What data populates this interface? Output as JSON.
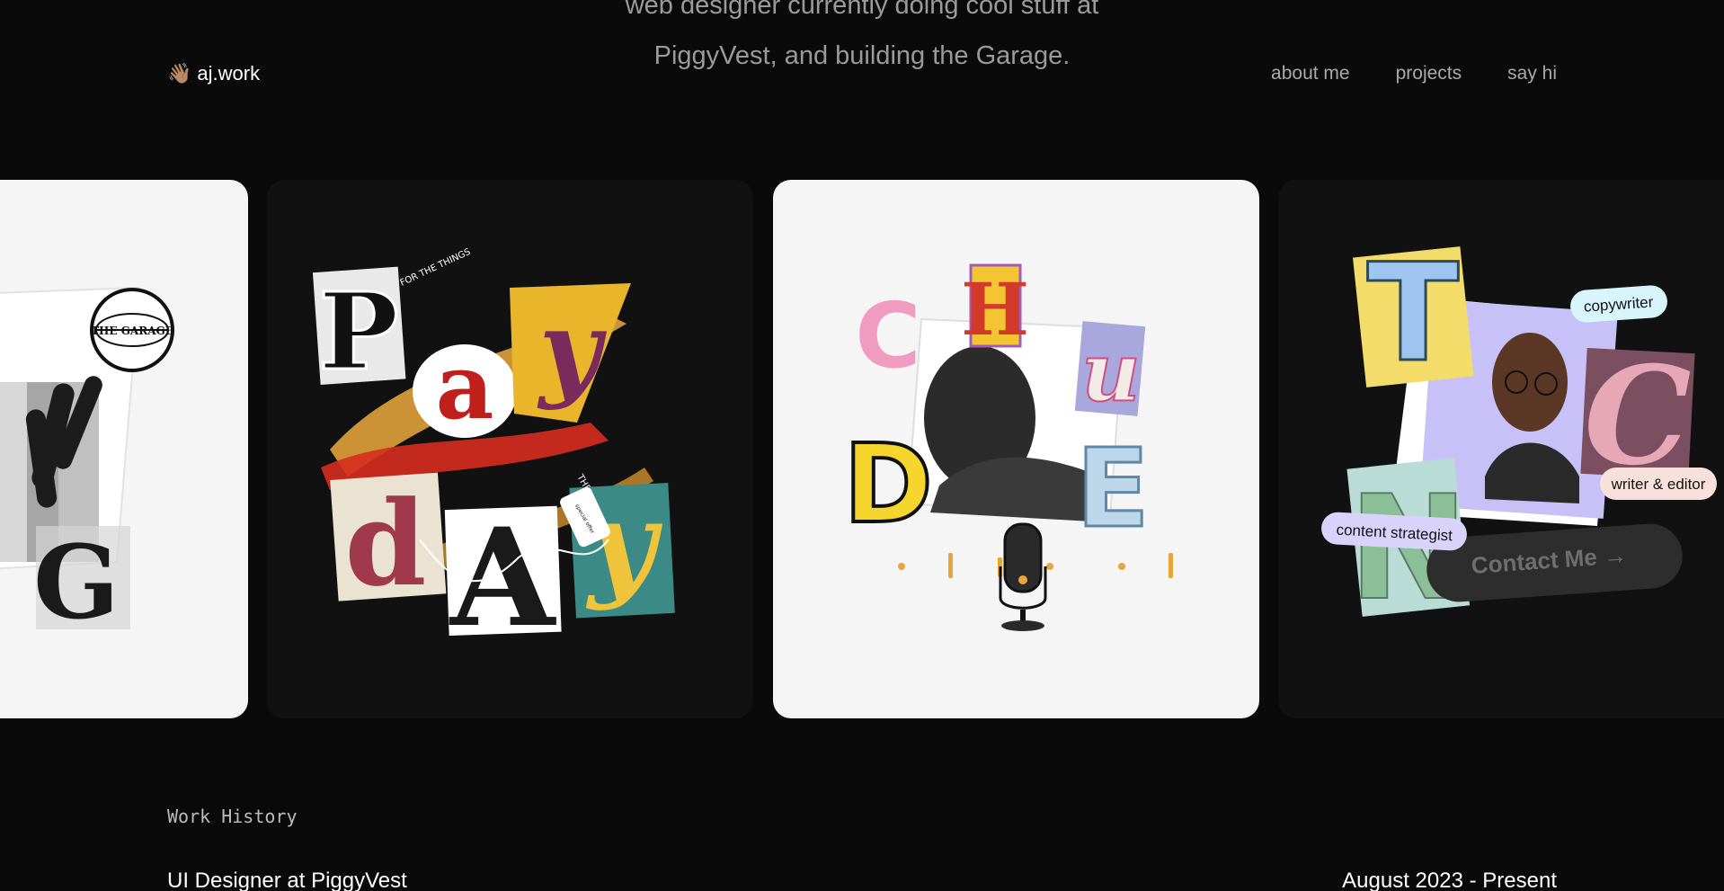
{
  "hero": {
    "line1": "web designer currently doing cool stuff at",
    "line2": "PiggyVest, and building the Garage."
  },
  "nav": {
    "brand_icon": "👋🏽",
    "brand": "aj.work",
    "links": [
      "about me",
      "projects",
      "say hi"
    ]
  },
  "projects": {
    "garage": {
      "badge": "THE GARAGE",
      "letter": "G"
    },
    "payday": {
      "letters": [
        "P",
        "a",
        "y",
        "d",
        "A",
        "y"
      ],
      "tagline": "FOR THE THINGS",
      "tagline_2": "THERE'S",
      "tag": "special offer"
    },
    "chude": {
      "letters": [
        "C",
        "H",
        "u",
        "D",
        "E"
      ]
    },
    "tcn": {
      "letters": [
        "T",
        "C",
        "N"
      ],
      "tags": [
        "copywriter",
        "writer & editor",
        "content strategist"
      ],
      "cta": "Contact Me →"
    }
  },
  "work_history": {
    "label": "Work History",
    "role": "UI Designer at PiggyVest",
    "period": "August 2023 - Present"
  },
  "colors": {
    "background": "#0a0a0a",
    "card_light": "#f5f5f5",
    "card_dark": "#111111",
    "nav_link": "#a9a9a9"
  }
}
